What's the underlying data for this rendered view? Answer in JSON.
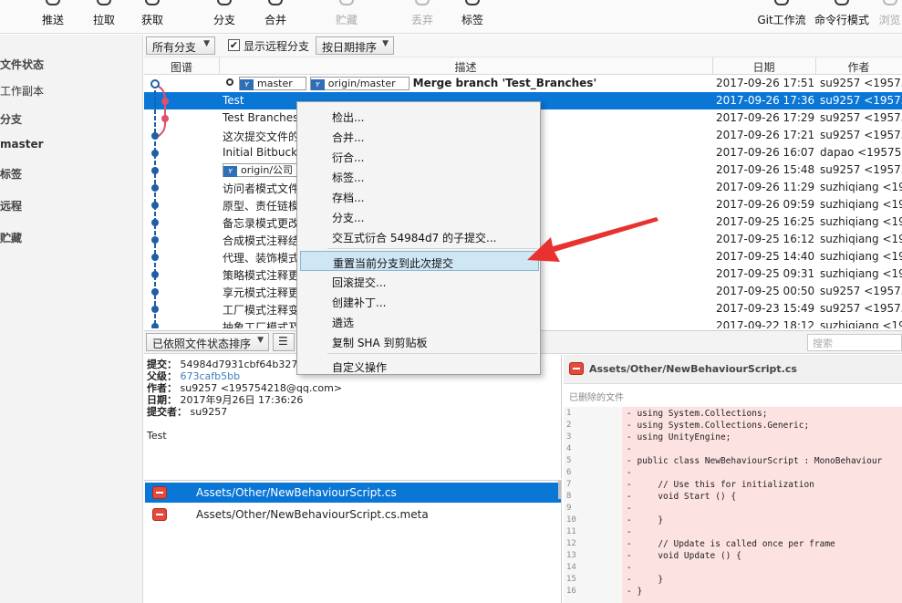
{
  "toolbar": {
    "buttons": [
      {
        "label": "推送",
        "icon": "push-icon",
        "enabled": true
      },
      {
        "label": "拉取",
        "icon": "pull-icon",
        "enabled": true
      },
      {
        "label": "获取",
        "icon": "fetch-icon",
        "enabled": true
      },
      {
        "label": "分支",
        "icon": "branch-icon",
        "enabled": true
      },
      {
        "label": "合并",
        "icon": "merge-icon",
        "enabled": true
      },
      {
        "label": "贮藏",
        "icon": "stash-icon",
        "enabled": false
      },
      {
        "label": "丢弃",
        "icon": "discard-icon",
        "enabled": false
      },
      {
        "label": "标签",
        "icon": "tag-icon",
        "enabled": true
      },
      {
        "label": "Git工作流",
        "icon": "git-flow-icon",
        "enabled": true
      },
      {
        "label": "命令行模式",
        "icon": "terminal-icon",
        "enabled": true
      },
      {
        "label": "浏览",
        "icon": "browse-icon",
        "enabled": false
      }
    ]
  },
  "sidebar": {
    "file_status_header": "文件状态",
    "working_copy": "工作副本",
    "branches_header": "分支",
    "current_branch": "master",
    "tags_header": "标签",
    "remotes_header": "远程",
    "stashes_header": "贮藏"
  },
  "filters": {
    "branch_filter": "所有分支",
    "show_remote_label": "显示远程分支",
    "show_remote_checked": true,
    "sort_order": "按日期排序"
  },
  "commit_table": {
    "columns": {
      "graph": "图谱",
      "description": "描述",
      "date": "日期",
      "author": "作者"
    },
    "rows": [
      {
        "refs": [
          {
            "name": "master",
            "head": true
          },
          {
            "name": "origin/master"
          }
        ],
        "message": "Merge branch 'Test_Branches'",
        "bold": true,
        "date": "2017-09-26 17:51",
        "author": "su9257 <195754"
      },
      {
        "refs": [],
        "message": "Test",
        "date": "2017-09-26 17:36",
        "author": "su9257 <195754",
        "selected": true
      },
      {
        "refs": [],
        "message": "Test Branches",
        "date": "2017-09-26 17:29",
        "author": "su9257 <195754"
      },
      {
        "refs": [],
        "message": "这次提交文件的",
        "date": "2017-09-26 17:21",
        "author": "su9257 <195754"
      },
      {
        "refs": [],
        "message": "Initial Bitbucke",
        "date": "2017-09-26 16:07",
        "author": "dapao <195754"
      },
      {
        "refs": [
          {
            "name": "origin/公司"
          }
        ],
        "message": "",
        "date": "2017-09-26 15:48",
        "author": "su9257 <195754"
      },
      {
        "refs": [],
        "message": "访问者模式文件",
        "date": "2017-09-26 11:29",
        "author": "suzhiqiang <19"
      },
      {
        "refs": [],
        "message": "原型、责任链模",
        "date": "2017-09-26 09:59",
        "author": "suzhiqiang <19"
      },
      {
        "refs": [],
        "message": "备忘录模式更改",
        "date": "2017-09-25 16:25",
        "author": "suzhiqiang <19"
      },
      {
        "refs": [],
        "message": "合成模式注释结",
        "date": "2017-09-25 16:12",
        "author": "suzhiqiang <19"
      },
      {
        "refs": [],
        "message": "代理、装饰模式",
        "date": "2017-09-25 14:40",
        "author": "suzhiqiang <19"
      },
      {
        "refs": [],
        "message": "策略模式注释更",
        "date": "2017-09-25 09:31",
        "author": "suzhiqiang <19"
      },
      {
        "refs": [],
        "message": "享元模式注释更",
        "date": "2017-09-25 00:50",
        "author": "su9257 <195754"
      },
      {
        "refs": [],
        "message": "工厂模式注释变",
        "date": "2017-09-23 15:49",
        "author": "su9257 <195754"
      },
      {
        "refs": [],
        "message": "抽象工厂模式及",
        "date": "2017-09-22 18:12",
        "author": "suzhiqiang <19"
      }
    ]
  },
  "context_menu": {
    "items": [
      {
        "label": "检出...",
        "separator_after": false
      },
      {
        "label": "合并...",
        "separator_after": false
      },
      {
        "label": "衍合...",
        "separator_after": false
      },
      {
        "label": "标签...",
        "separator_after": false
      },
      {
        "label": "存档...",
        "separator_after": false
      },
      {
        "label": "分支...",
        "separator_after": false
      },
      {
        "label": "交互式衍合 54984d7 的子提交...",
        "separator_after": true
      },
      {
        "label": "重置当前分支到此次提交",
        "separator_after": false,
        "highlight": true
      },
      {
        "label": "回滚提交...",
        "separator_after": false
      },
      {
        "label": "创建补丁...",
        "separator_after": false
      },
      {
        "label": "遴选",
        "separator_after": false
      },
      {
        "label": "复制 SHA 到剪贴板",
        "separator_after": true
      },
      {
        "label": "自定义操作",
        "separator_after": false
      }
    ]
  },
  "bottom_bar": {
    "file_sort": "已依照文件状态排序",
    "search_placeholder": "搜索"
  },
  "details": {
    "commit_key": "提交：",
    "commit_value": "54984d7931cbf64b327",
    "parent_key": "父级：",
    "parent_value": "673cafb5bb",
    "author_key": "作者：",
    "author_value": "su9257 <195754218@qq.com>",
    "date_key": "日期：",
    "date_value": "2017年9月26日 17:36:26",
    "committer_key": "提交者：",
    "committer_value": "su9257",
    "message": "Test"
  },
  "files": [
    {
      "name": "Assets/Other/NewBehaviourScript.cs",
      "status": "removed",
      "selected": true
    },
    {
      "name": "Assets/Other/NewBehaviourScript.cs.meta",
      "status": "removed",
      "selected": false
    }
  ],
  "diff": {
    "file_path": "Assets/Other/NewBehaviourScript.cs",
    "status_text": "已删除的文件",
    "lines": [
      {
        "num": "1",
        "text": "- using System.Collections;"
      },
      {
        "num": "2",
        "text": "- using System.Collections.Generic;"
      },
      {
        "num": "3",
        "text": "- using UnityEngine;"
      },
      {
        "num": "4",
        "text": "-"
      },
      {
        "num": "5",
        "text": "- public class NewBehaviourScript : MonoBehaviour"
      },
      {
        "num": "6",
        "text": "-"
      },
      {
        "num": "7",
        "text": "-     // Use this for initialization"
      },
      {
        "num": "8",
        "text": "-     void Start () {"
      },
      {
        "num": "9",
        "text": "-"
      },
      {
        "num": "10",
        "text": "-     }"
      },
      {
        "num": "11",
        "text": "-"
      },
      {
        "num": "12",
        "text": "-     // Update is called once per frame"
      },
      {
        "num": "13",
        "text": "-     void Update () {"
      },
      {
        "num": "14",
        "text": "-"
      },
      {
        "num": "15",
        "text": "-     }"
      },
      {
        "num": "16",
        "text": "- }"
      }
    ]
  },
  "colors": {
    "selection": "#0a76d6",
    "menu_highlight": "#cfe6f5",
    "graph_blue": "#1f5fa8",
    "graph_pink": "#e04f6b",
    "annotation_arrow": "#e8322f"
  }
}
